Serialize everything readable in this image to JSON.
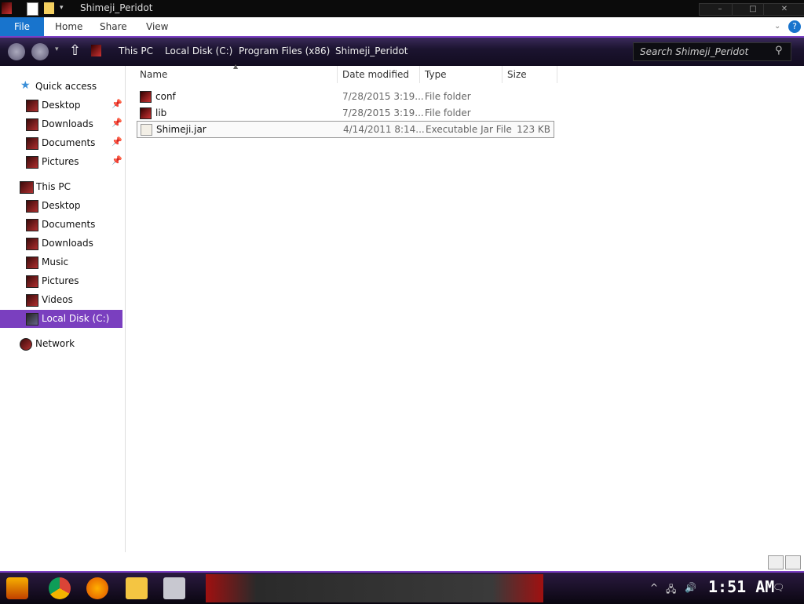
{
  "window": {
    "title": "Shimeji_Peridot",
    "controls": {
      "minimize": "–",
      "maximize": "□",
      "close": "✕"
    }
  },
  "ribbon": {
    "tabs": [
      "File",
      "Home",
      "Share",
      "View"
    ],
    "help_icon": "?"
  },
  "address": {
    "breadcrumbs": [
      "This PC",
      "Local Disk (C:)",
      "Program Files (x86)",
      "Shimeji_Peridot"
    ],
    "search_placeholder": "Search Shimeji_Peridot"
  },
  "nav": {
    "quick_access": {
      "label": "Quick access",
      "items": [
        {
          "label": "Desktop",
          "pinned": true
        },
        {
          "label": "Downloads",
          "pinned": true
        },
        {
          "label": "Documents",
          "pinned": true
        },
        {
          "label": "Pictures",
          "pinned": true
        }
      ]
    },
    "this_pc": {
      "label": "This PC",
      "items": [
        {
          "label": "Desktop"
        },
        {
          "label": "Documents"
        },
        {
          "label": "Downloads"
        },
        {
          "label": "Music"
        },
        {
          "label": "Pictures"
        },
        {
          "label": "Videos"
        },
        {
          "label": "Local Disk (C:)",
          "selected": true
        }
      ]
    },
    "network": {
      "label": "Network"
    }
  },
  "files": {
    "columns": [
      "Name",
      "Date modified",
      "Type",
      "Size"
    ],
    "rows": [
      {
        "name": "conf",
        "date": "7/28/2015 3:19...",
        "type": "File folder",
        "size": ""
      },
      {
        "name": "lib",
        "date": "7/28/2015 3:19...",
        "type": "File folder",
        "size": ""
      },
      {
        "name": "Shimeji.jar",
        "date": "4/14/2011 8:14...",
        "type": "Executable Jar File",
        "size": "123 KB"
      }
    ]
  },
  "taskbar": {
    "clock": "1:51 AM"
  },
  "colors": {
    "accent": "#7a3fbf",
    "file_tab": "#1874cd"
  }
}
